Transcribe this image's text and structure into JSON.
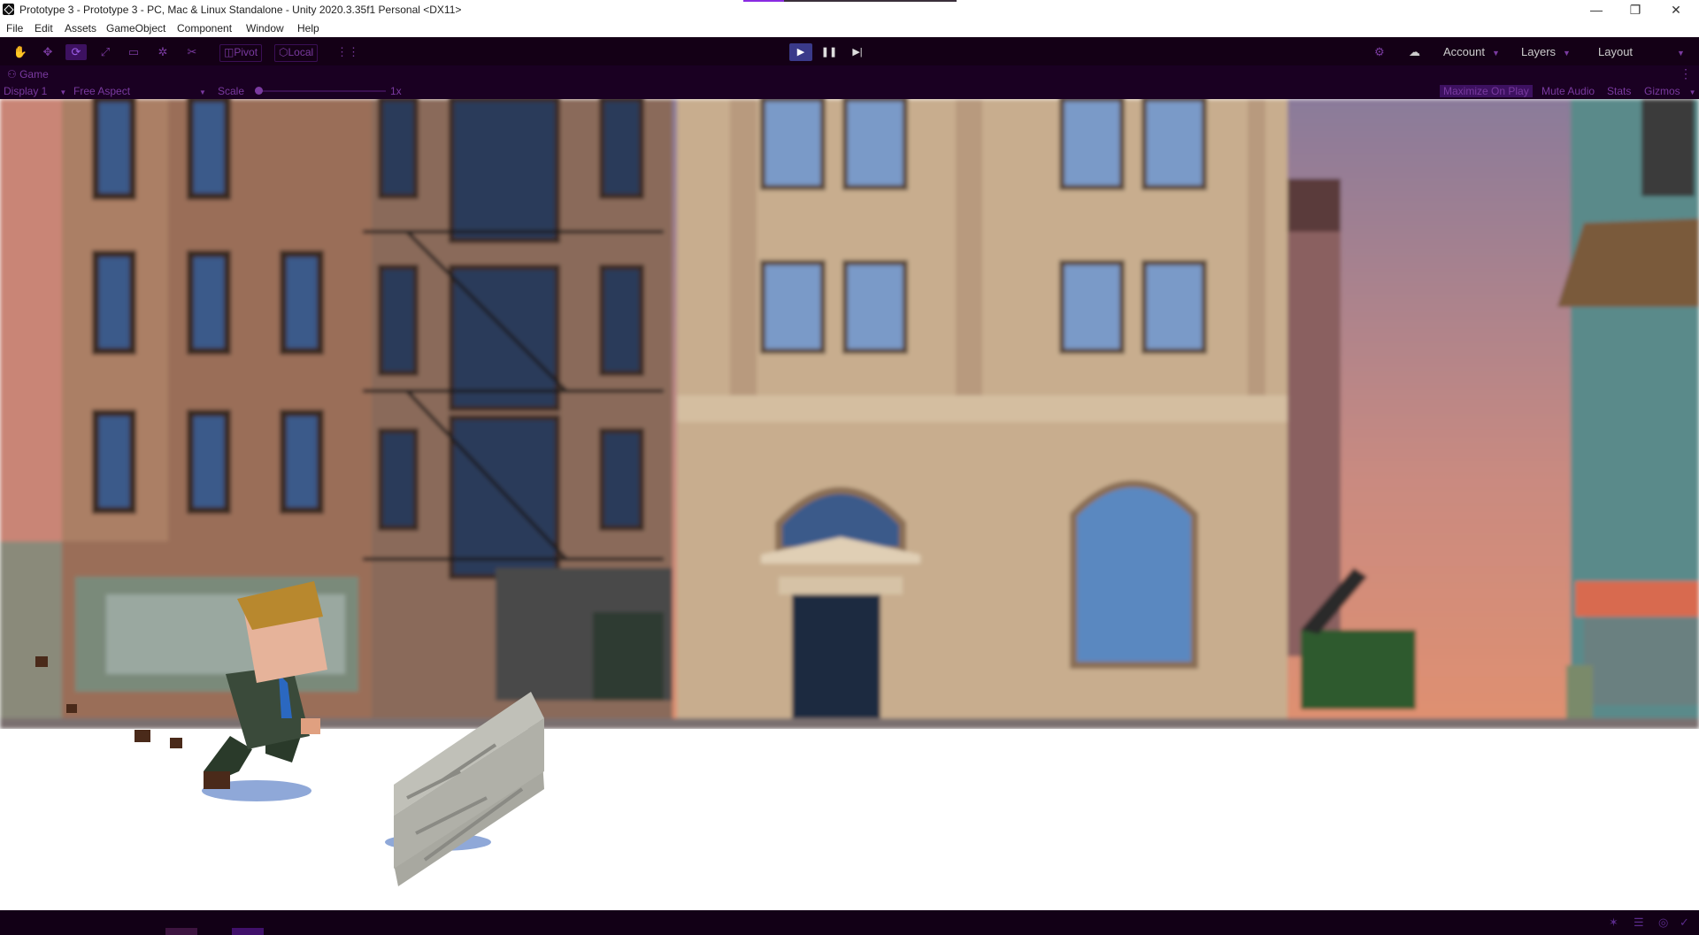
{
  "window": {
    "title": "Prototype 3 - Prototype 3 - PC, Mac & Linux Standalone - Unity 2020.3.35f1 Personal <DX11>",
    "progress": 0.19,
    "controls": {
      "minimize": "—",
      "restore": "❐",
      "close": "✕"
    }
  },
  "menu": [
    "File",
    "Edit",
    "Assets",
    "GameObject",
    "Component",
    "Window",
    "Help"
  ],
  "toolbar": {
    "tools": [
      "hand-tool",
      "move-tool",
      "rotate-tool",
      "scale-tool",
      "rect-tool",
      "transform-tool",
      "custom-tool"
    ],
    "active_tool": "rotate-tool",
    "pivot_label": "Pivot",
    "local_label": "Local",
    "play": {
      "play": "▶",
      "pause": "❚❚",
      "step": "▶|"
    },
    "account_label": "Account",
    "layers_label": "Layers",
    "layout_label": "Layout"
  },
  "game_view": {
    "tab_label": "Game",
    "display": "Display 1",
    "aspect": "Free Aspect",
    "scale_label": "Scale",
    "scale_value": "1x",
    "maximize_on_play": "Maximize On Play",
    "mute_audio": "Mute Audio",
    "stats": "Stats",
    "gizmos": "Gizmos"
  },
  "colors": {
    "editor_bg": "#140016",
    "accent": "#7a3aa0",
    "active": "#3d1160"
  }
}
